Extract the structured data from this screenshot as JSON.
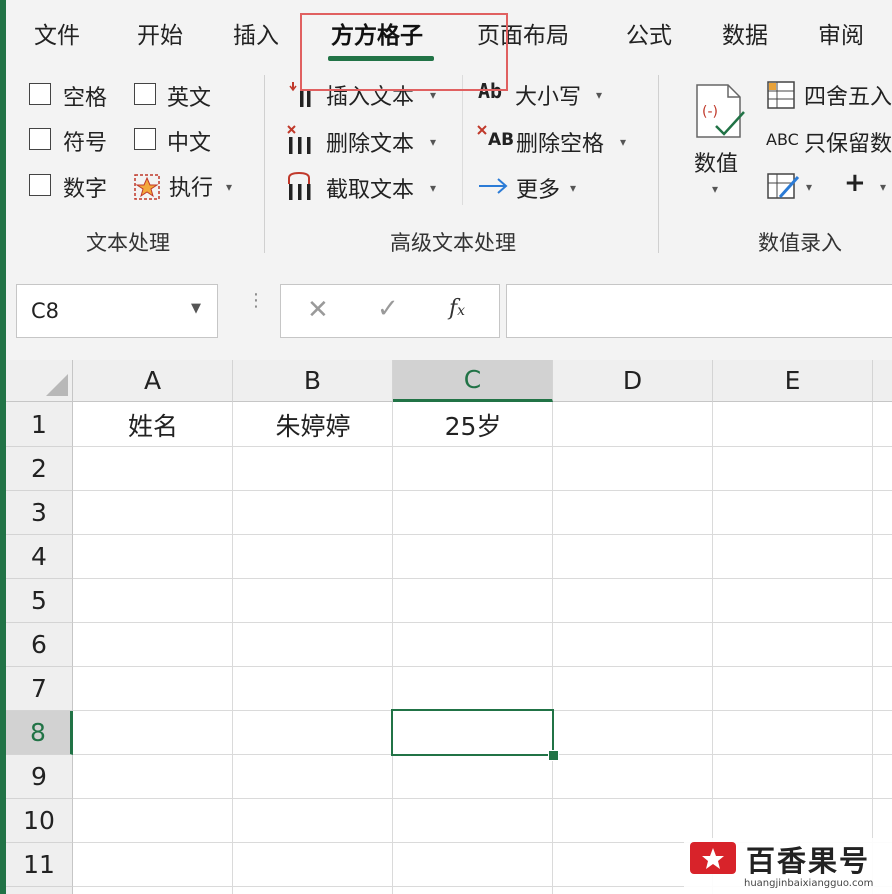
{
  "tabs": [
    "文件",
    "开始",
    "插入",
    "方方格子",
    "页面布局",
    "公式",
    "数据",
    "审阅"
  ],
  "ribbon": {
    "checkboxes": [
      "空格",
      "英文",
      "符号",
      "中文",
      "数字"
    ],
    "execute_label": "执行",
    "text_group_label": "文本处理",
    "insert_text": "插入文本",
    "delete_text": "删除文本",
    "extract_text": "截取文本",
    "case_label": "大小写",
    "delete_space": "删除空格",
    "more_label": "更多",
    "adv_group_label": "高级文本处理",
    "numeric_button": "数值",
    "round_label": "四舍五入",
    "keep_label": "只保留数",
    "num_group_label": "数值录入",
    "ab_glyph": "Ab",
    "abc_glyph": "ABC",
    "xab_glyph": "AB"
  },
  "formula_bar": {
    "name_box": "C8",
    "formula": ""
  },
  "grid": {
    "columns": [
      "A",
      "B",
      "C",
      "D",
      "E"
    ],
    "rows": [
      "1",
      "2",
      "3",
      "4",
      "5",
      "6",
      "7",
      "8",
      "9",
      "10",
      "11"
    ],
    "cells": {
      "A1": "姓名",
      "B1": "朱婷婷",
      "C1": "25岁"
    }
  },
  "watermark": {
    "name": "百香果号",
    "url": "huangjinbaixiangguo.com"
  },
  "colors": {
    "accent": "#217346",
    "highlight_box": "#e06060"
  }
}
